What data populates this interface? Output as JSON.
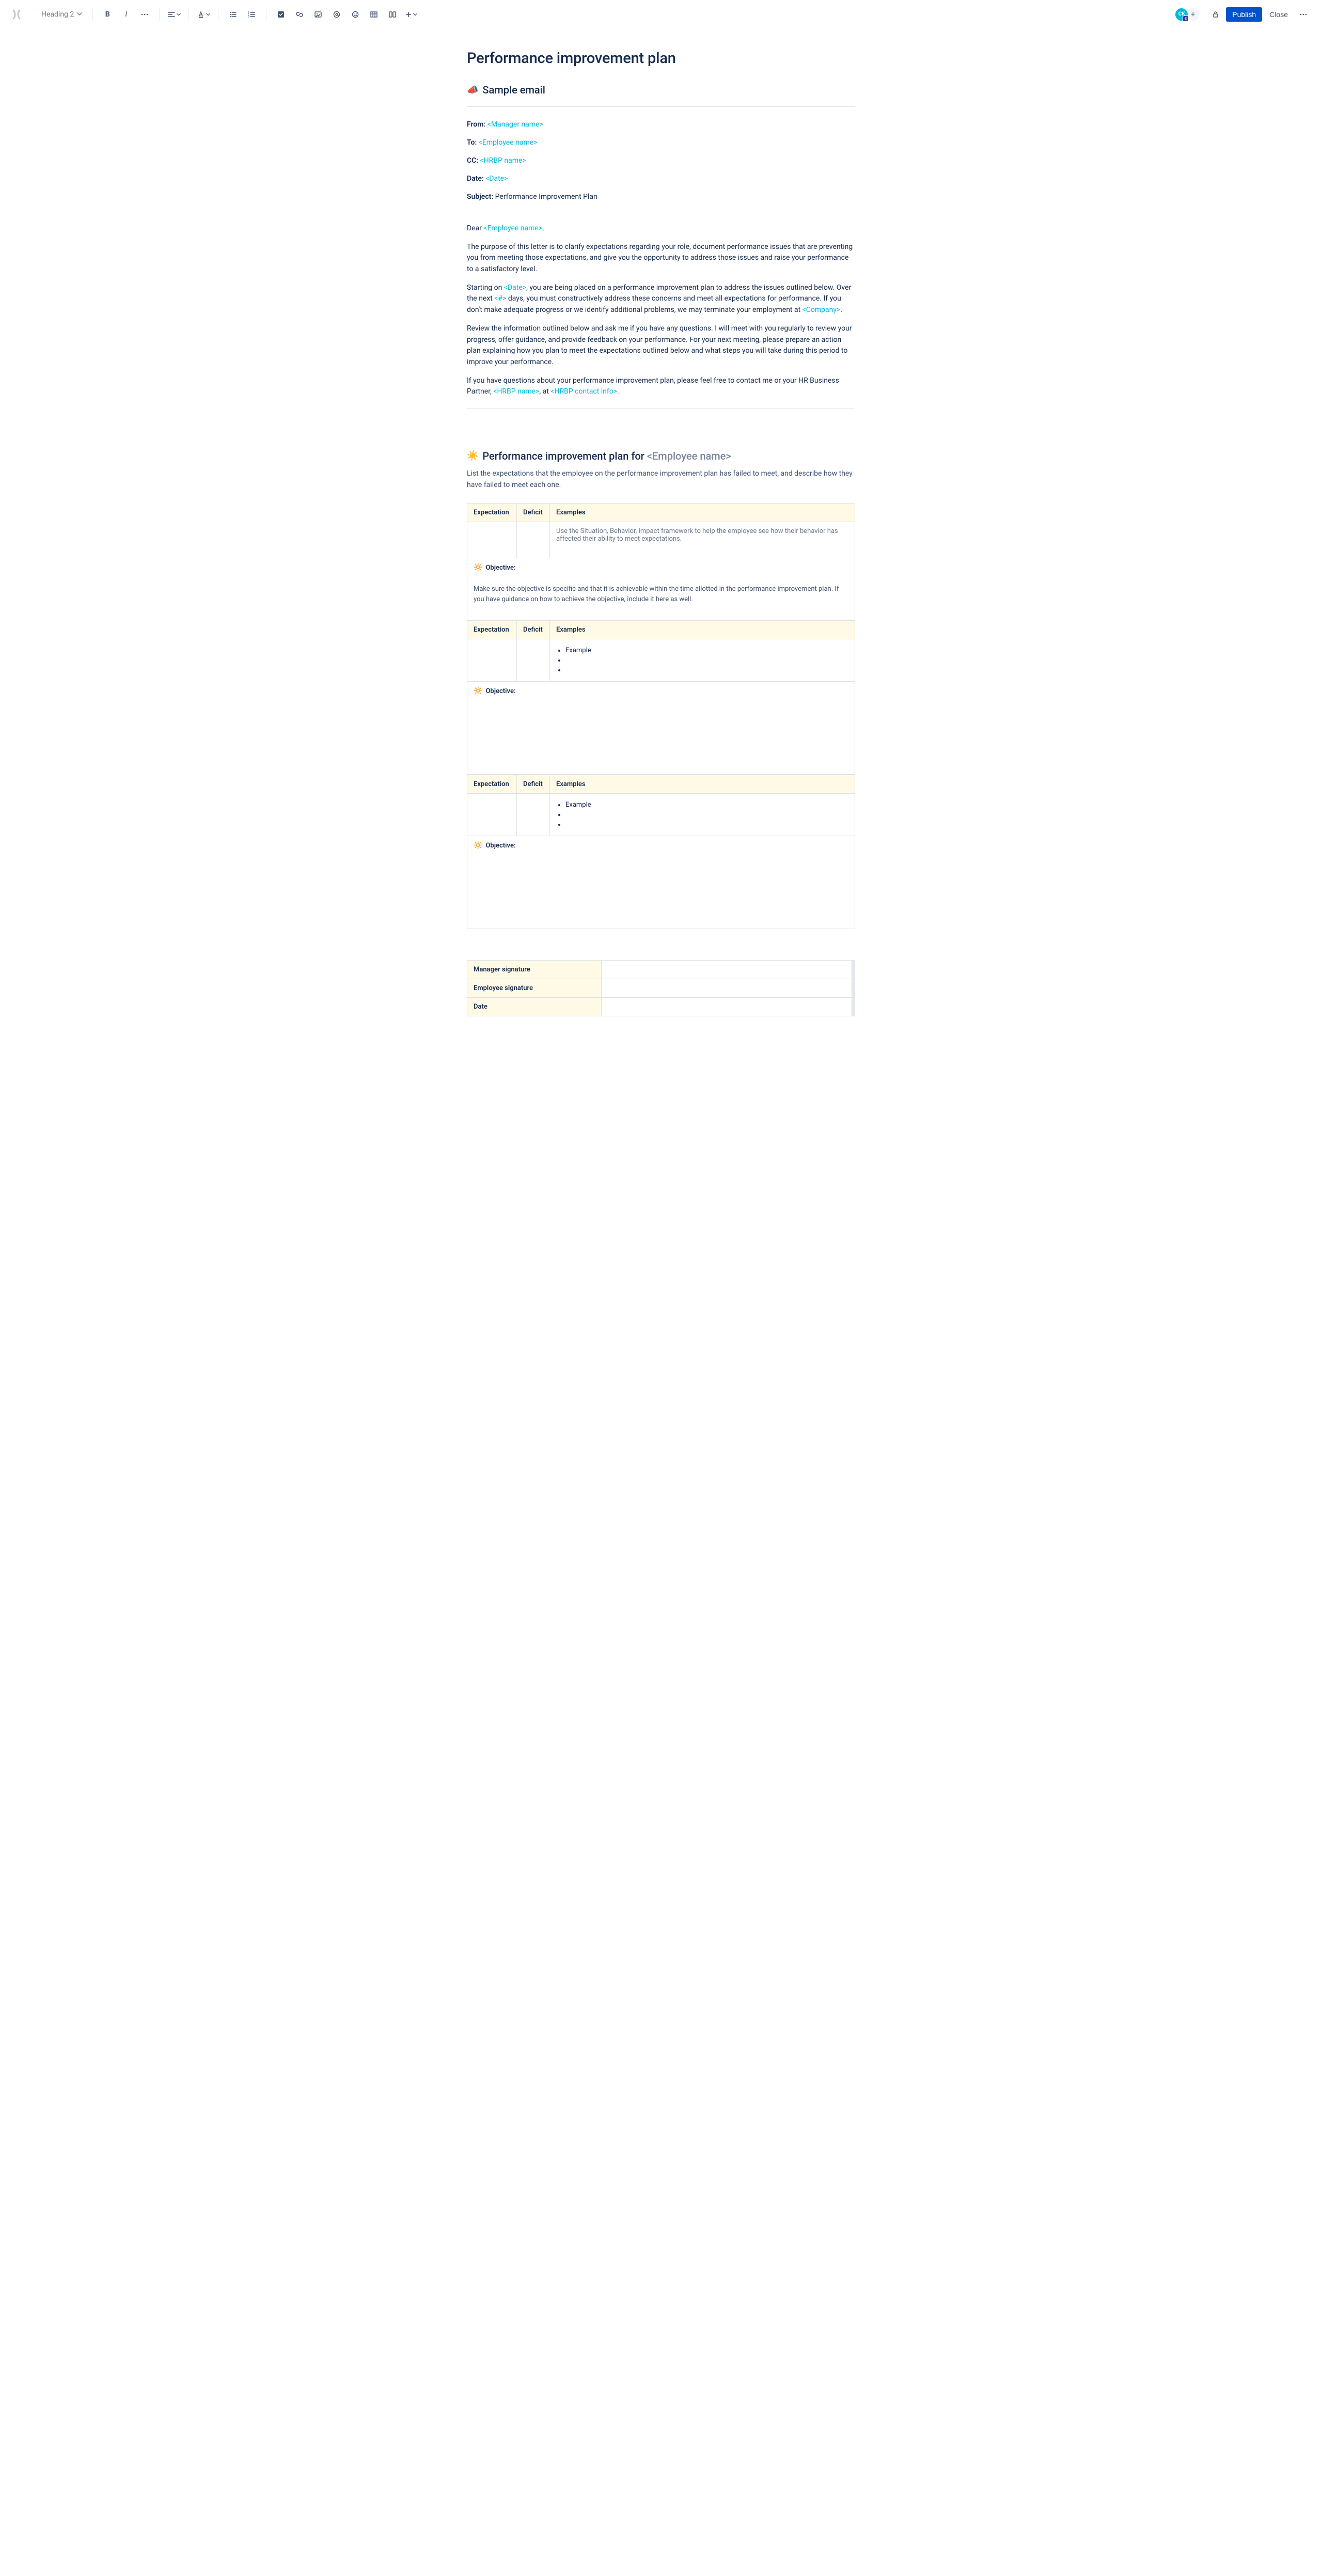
{
  "toolbar": {
    "style_select": "Heading 2",
    "avatar_initials": "CK",
    "publish": "Publish",
    "close": "Close"
  },
  "page": {
    "title": "Performance improvement plan"
  },
  "sample_email": {
    "heading": "Sample email",
    "from_label": "From:",
    "from_ph": "<Manager name>",
    "to_label": "To:",
    "to_ph": "<Employee name>",
    "cc_label": "CC:",
    "cc_ph": "<HRBP name>",
    "date_label": "Date:",
    "date_ph": "<Date>",
    "subject_label": "Subject:",
    "subject_value": "Performance Improvement Plan",
    "salutation_pre": "Dear ",
    "salutation_ph": "<Employee name>",
    "salutation_post": ",",
    "p1": "The purpose of this letter is to clarify expectations regarding your role, document performance issues that are preventing you from meeting those expectations, and give you the opportunity to address those issues and raise your performance to a satisfactory level.",
    "p2_a": "Starting on ",
    "p2_ph1": "<Date>",
    "p2_b": ", you are being placed on a performance improvement plan to address the issues outlined below. Over the next ",
    "p2_ph2": "<#>",
    "p2_c": " days, you must constructively address these concerns and meet all expectations for performance. If you don't make adequate progress or we identify additional problems, we may terminate your employment at ",
    "p2_ph3": "<Company>",
    "p2_d": ".",
    "p3": "Review the information outlined below and ask me if you have any questions. I will meet with you regularly to review your progress, offer guidance, and provide feedback on your performance. For your next meeting, please prepare an action plan explaining how you plan to meet the expectations outlined below and what steps you will take during this period to improve your performance.",
    "p4_a": "If you have questions about your performance improvement plan, please feel free to contact me or your HR Business Partner, ",
    "p4_ph1": "<HRBP name>",
    "p4_b": ", at ",
    "p4_ph2": "<HRBP contact info>",
    "p4_c": "."
  },
  "pip": {
    "heading_pre": "Performance improvement plan for ",
    "heading_ph": "<Employee name>",
    "helper": "List the expectations that the employee on the performance improvement plan has failed to meet, and describe how they have failed to meet each one.",
    "headers": {
      "expectation": "Expectation",
      "deficit": "Deficit",
      "examples": "Examples"
    },
    "hint": "Use the Situation, Behavior, Impact framework to help the employee see how their behavior has affected their ability to meet expectations.",
    "objective_label": "Objective:",
    "objective_note": "Make sure the objective is specific and that it is achievable within the time allotted in the performance improvement plan. If you have guidance on how to achieve the objective, include it here as well.",
    "example_item": "Example"
  },
  "signatures": {
    "manager": "Manager signature",
    "employee": "Employee signature",
    "date": "Date"
  }
}
